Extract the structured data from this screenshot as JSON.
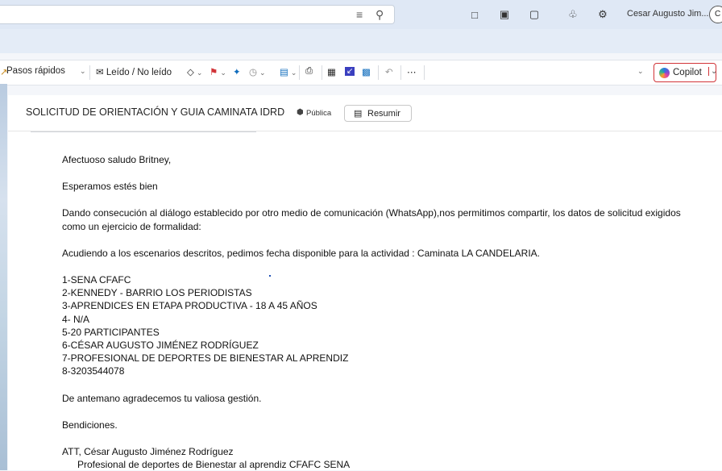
{
  "topbar": {
    "user_name": "Cesar Augusto Jim...",
    "avatar_initial": "C"
  },
  "ribbon": {
    "quick_steps": "Pasos rápidos",
    "read_unread": "Leído / No leído",
    "copilot": "Copilot"
  },
  "message": {
    "subject": "SOLICITUD DE ORIENTACIÓN Y GUIA CAMINATA IDRD",
    "sensitivity": "Pública",
    "summarize": "Resumir",
    "greeting": "Afectuoso saludo Britney,",
    "p1": "Esperamos estés bien",
    "p2": "Dando consecución al diálogo establecido por otro medio de comunicación (WhatsApp),nos permitimos compartir, los datos de solicitud exigidos como un ejercicio de formalidad:",
    "p3": "Acudiendo a los escenarios descritos, pedimos fecha disponible para la actividad : Caminata LA CANDELARIA.",
    "list": [
      "1-SENA CFAFC",
      "2-KENNEDY - BARRIO LOS PERIODISTAS",
      "3-APRENDICES EN ETAPA PRODUCTIVA - 18 A 45 AÑOS",
      "4- N/A",
      "5-20 PARTICIPANTES",
      "6-CÉSAR AUGUSTO JIMÉNEZ RODRÍGUEZ",
      "7-PROFESIONAL DE DEPORTES DE BIENESTAR AL APRENDIZ",
      "8-3203544078"
    ],
    "thanks": "De antemano agradecemos tu valiosa gestión.",
    "blessing": "Bendiciones.",
    "signature": "ATT, César Augusto Jiménez Rodríguez",
    "signature_title": "Profesional de deportes de Bienestar al aprendiz CFAFC SENA"
  },
  "colors": {
    "accent": "#0f6cbd",
    "flag": "#d13438",
    "copilot_border": "#d13438"
  },
  "icons": [
    "filter-icon",
    "search-icon",
    "teams-chat-icon",
    "office-icon",
    "feedback-icon",
    "bell-icon",
    "settings-icon",
    "tag-icon",
    "flag-icon",
    "pin-icon",
    "clock-icon",
    "move-icon",
    "print-icon",
    "apps-icon",
    "pdf-icon",
    "rules-icon",
    "undo-icon",
    "more-icon",
    "chevron-down-icon"
  ]
}
